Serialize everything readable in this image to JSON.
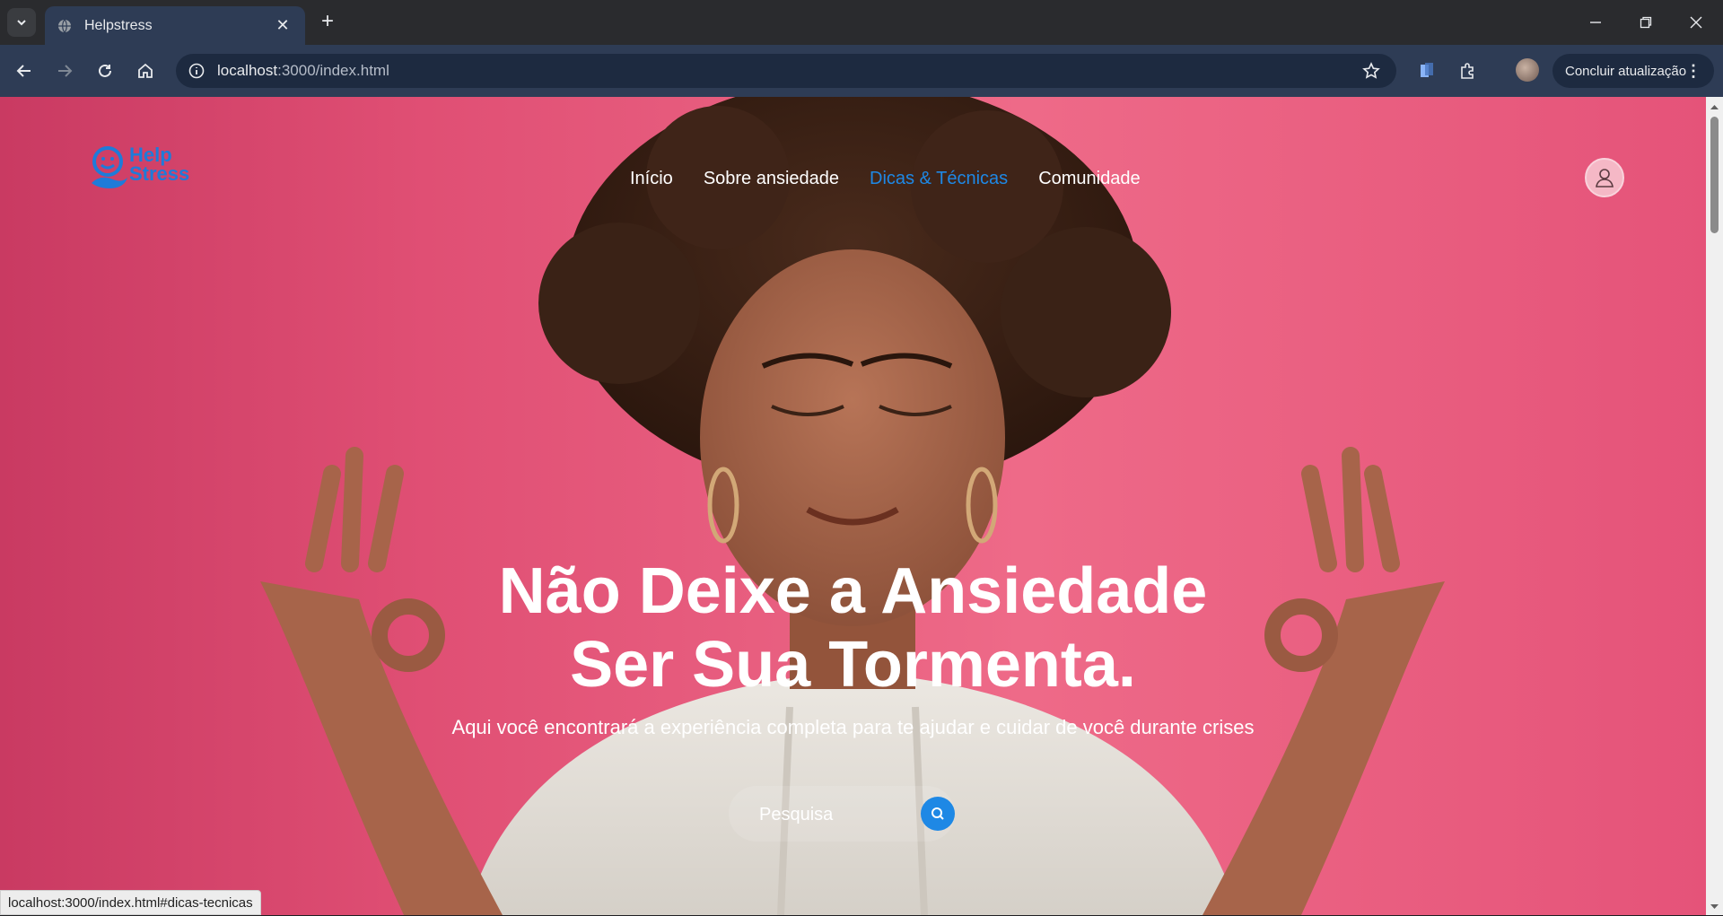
{
  "browser": {
    "tab_title": "Helpstress",
    "url_host": "localhost",
    "url_path": ":3000/index.html",
    "update_label": "Concluir atualização",
    "status_url": "localhost:3000/index.html#dicas-tecnicas"
  },
  "header": {
    "logo_line1": "Help",
    "logo_line2": "Stress",
    "nav": [
      {
        "label": "Início",
        "active": false
      },
      {
        "label": "Sobre ansiedade",
        "active": false
      },
      {
        "label": "Dicas & Técnicas",
        "active": true
      },
      {
        "label": "Comunidade",
        "active": false
      }
    ]
  },
  "hero": {
    "title_line1": "Não Deixe a Ansiedade",
    "title_line2": "Ser Sua Tormenta.",
    "subtitle": "Aqui você encontrará a experiência completa para te ajudar e cuidar de você durante crises",
    "search_placeholder": "Pesquisa"
  },
  "colors": {
    "accent": "#1e88e5",
    "background_pink": "#e85a7c",
    "chrome": "#2e3c55"
  },
  "icons": [
    "tab-search-icon",
    "globe-icon",
    "close-icon",
    "plus-icon",
    "minimize-icon",
    "restore-icon",
    "back-icon",
    "forward-icon",
    "reload-icon",
    "home-icon",
    "info-icon",
    "star-icon",
    "extension-icon",
    "user-icon",
    "search-icon"
  ]
}
